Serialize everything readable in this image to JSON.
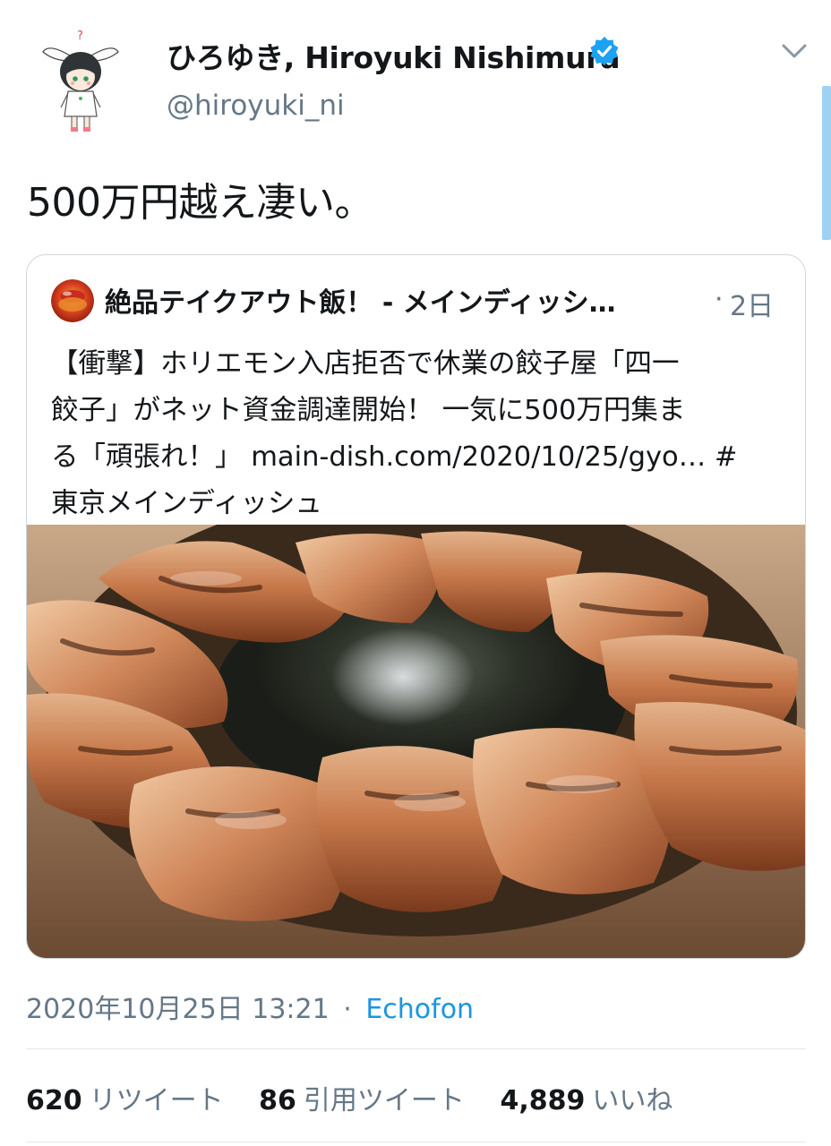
{
  "author": {
    "display_name": "ひろゆき, Hiroyuki Nishimura",
    "handle": "@hiroyuki_ni",
    "verified": true,
    "avatar_icon": "anime-character-avatar"
  },
  "tweet": {
    "text": "500万円越え凄い。"
  },
  "quoted": {
    "name": "絶品テイクアウト飯！ - メインディッシ…",
    "dot": "·",
    "time": "2日",
    "body_lines": [
      "【衝撃】ホリエモン入店拒否で休業の餃子屋「四一",
      "餃子」がネット資金調達開始！ 一気に500万円集ま",
      "る「頑張れ！」 main-dish.com/2020/10/25/gyo… #",
      "東京メインディッシュ"
    ],
    "image_icon": "gyoza-photo"
  },
  "meta": {
    "timestamp": "2020年10月25日 13:21",
    "separator": "·",
    "client": "Echofon"
  },
  "stats": {
    "retweets": {
      "count": "620",
      "label": "リツイート"
    },
    "quotes": {
      "count": "86",
      "label": "引用ツイート"
    },
    "likes": {
      "count": "4,889",
      "label": "いいね"
    }
  },
  "colors": {
    "link": "#1b95e0",
    "verified": "#1da1f2",
    "secondary_text": "#657786",
    "border": "#ccd6dd"
  }
}
